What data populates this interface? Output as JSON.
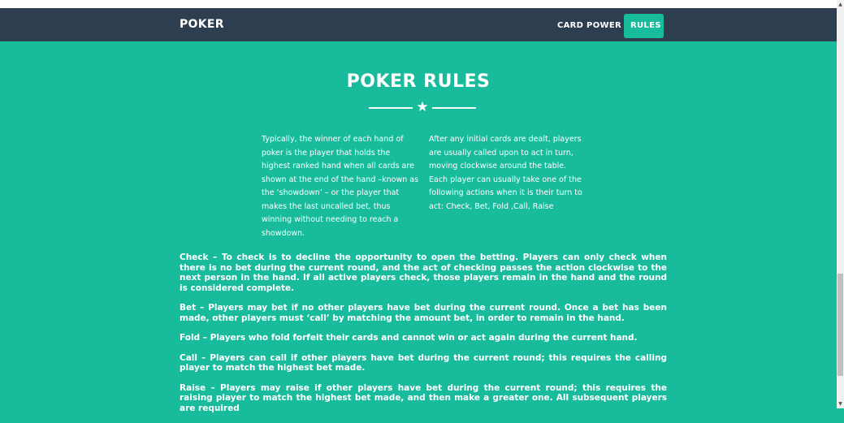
{
  "nav": {
    "brand": "POKER",
    "links": [
      "CARD POWER",
      "RULES"
    ],
    "active": "RULES",
    "bg_color": "#2c3e50",
    "active_color": "#18bc9c"
  },
  "main": {
    "title": "POKER RULES",
    "divider_icon": "star-icon",
    "intro_left": "Typically, the winner of each hand of poker is the player that holds the highest ranked hand when all cards are shown at the end of the hand –known as the ‘showdown’ – or the player that makes the last uncalled bet, thus winning without needing to reach a showdown.",
    "intro_right": "After any initial cards are dealt, players are usually called upon to act in turn, moving clockwise around the table. Each player can usually take one of the following actions when it is their turn to act: Check, Bet, Fold ,Call, Raise",
    "rules": [
      "Check – To check is to decline the opportunity to open the betting. Players can only check when there is no bet during the current round, and the act of checking passes the action clockwise to the next person in the hand. If all active players check, those players remain in the hand and the round is considered complete.",
      "Bet – Players may bet if no other players have bet during the current round. Once a bet has been made, other players must ‘call’ by matching the amount bet, in order to remain in the hand.",
      "Fold – Players who fold forfeit their cards and cannot win or act again during the current hand.",
      "Call – Players can call if other players have bet during the current round; this requires the calling player to match the highest bet made.",
      "Raise – Players may raise if other players have bet during the current round; this requires the raising player to match the highest bet made, and then make a greater one. All subsequent players are required"
    ],
    "bg_color": "#18bc9c"
  },
  "icons": {
    "star": "★",
    "scroll_up": "▲",
    "scroll_down": "▼"
  }
}
